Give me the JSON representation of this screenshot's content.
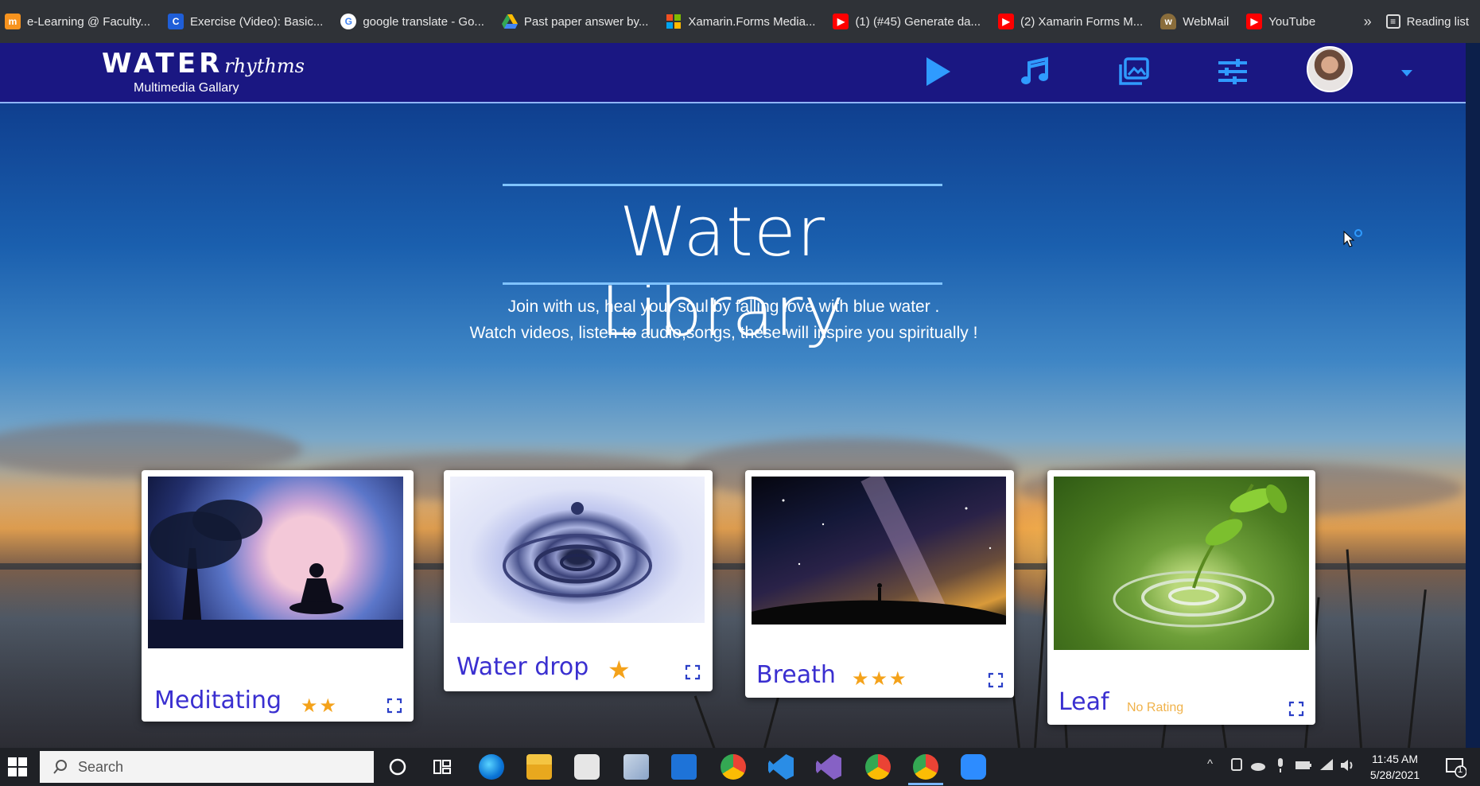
{
  "bookmarks": [
    {
      "label": "e-Learning @ Faculty...",
      "icon": "moodle-icon",
      "color": "#f7931e"
    },
    {
      "label": "Exercise (Video): Basic...",
      "icon": "c-icon",
      "color": "#1f5ed8"
    },
    {
      "label": "google translate - Go...",
      "icon": "google-icon",
      "color": "#ffffff"
    },
    {
      "label": "Past paper answer by...",
      "icon": "drive-icon",
      "color": "#34a853"
    },
    {
      "label": "Xamarin.Forms Media...",
      "icon": "microsoft-icon",
      "color": "#f25022"
    },
    {
      "label": "(1) (#45) Generate da...",
      "icon": "youtube-icon",
      "color": "#ff0000"
    },
    {
      "label": "(2) Xamarin Forms M...",
      "icon": "youtube-icon",
      "color": "#ff0000"
    },
    {
      "label": "WebMail",
      "icon": "webmail-icon",
      "color": "#8a6d3b"
    },
    {
      "label": "YouTube",
      "icon": "youtube-icon",
      "color": "#ff0000"
    }
  ],
  "bookmarks_more": "»",
  "reading_list": "Reading list",
  "app": {
    "logo_main": "WATER",
    "logo_script": "rhythms",
    "logo_sub": "Multimedia Gallary",
    "accent": "#2f9bff",
    "header_bg": "#1a1782"
  },
  "hero": {
    "title": "Water Library",
    "line1": "Join with us, heal your soul by falling love with blue water .",
    "line2": "Watch videos, listen to audio,songs, these will inspire you spiritually !"
  },
  "cards": [
    {
      "title": "Meditating",
      "stars": "★★",
      "rating_text": ""
    },
    {
      "title": "Water drop",
      "stars": "★",
      "rating_text": ""
    },
    {
      "title": "Breath",
      "stars": "★★★",
      "rating_text": ""
    },
    {
      "title": "Leaf",
      "stars": "",
      "rating_text": "No Rating"
    }
  ],
  "taskbar": {
    "search_placeholder": "Search",
    "time": "11:45 AM",
    "date": "5/28/2021",
    "notification_count": "1"
  }
}
